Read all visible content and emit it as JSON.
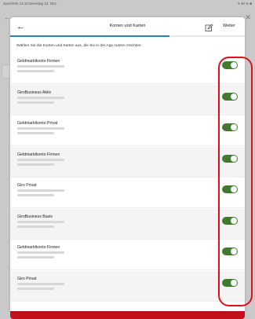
{
  "status_bar": {
    "left": "4posiTAN  14:10  Dienstag 13. Dez.",
    "right": "▾ 49 % ■"
  },
  "header": {
    "back_glyph": "←",
    "title": "Konten und Karten",
    "edit_icon": "edit-icon",
    "next_label": "Weiter",
    "progress_fraction": 0.68,
    "progress_color": "#2a7bd6"
  },
  "instruction": "Wählen Sie die Konten und Karten aus, die Sie in der App nutzen möchten:",
  "accounts": [
    {
      "name": "Geldmarktkonto Firmen",
      "enabled": true
    },
    {
      "name": "GiroBusiness Aktiv",
      "enabled": true
    },
    {
      "name": "Geldmarktkonto Privat",
      "enabled": true
    },
    {
      "name": "Geldmarktkonto Firmen",
      "enabled": true
    },
    {
      "name": "Giro Privat",
      "enabled": true
    },
    {
      "name": "GiroBusiness Basis",
      "enabled": true
    },
    {
      "name": "Geldmarktkonto Firmen",
      "enabled": true
    },
    {
      "name": "Giro Privat",
      "enabled": true
    }
  ],
  "colors": {
    "toggle_on": "#3f7a2d",
    "highlight": "#e0101b",
    "brand_red": "#c4101a"
  }
}
